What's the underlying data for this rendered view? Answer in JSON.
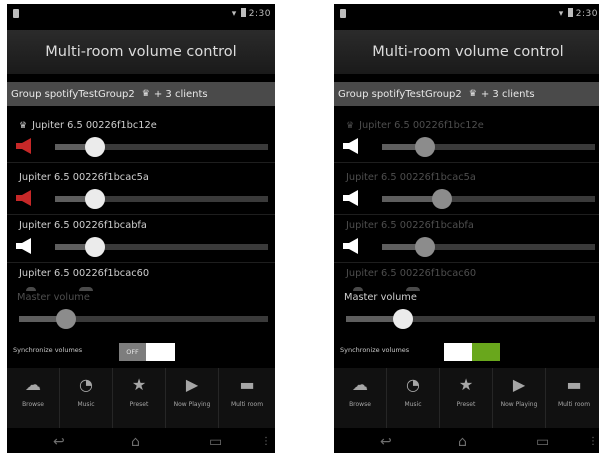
{
  "status": {
    "time": "2:30"
  },
  "title": "Multi-room volume control",
  "group": {
    "name": "Group spotifyTestGroup2",
    "clients": "+ 3 clients"
  },
  "clients": {
    "c0": "Jupiter 6.5 00226f1bc12e",
    "c1": "Jupiter 6.5 00226f1bcac5a",
    "c2": "Jupiter 6.5 00226f1bcabfa",
    "c3": "Jupiter 6.5 00226f1bcac60"
  },
  "master_label": "Master volume",
  "sync_label": "Synchronize volumes",
  "sync_off_text": "OFF",
  "nav": {
    "n0": "Browse",
    "n1": "Music",
    "n2": "Preset",
    "n3": "Now Playing",
    "n4": "Multi room"
  },
  "screens": [
    {
      "client_levels": [
        0.19,
        0.19,
        0.19
      ],
      "master_level": 0.19,
      "sync_on": false
    },
    {
      "client_levels": [
        0.2,
        0.28,
        0.2
      ],
      "master_level": 0.23,
      "sync_on": true
    }
  ],
  "colors": {
    "accent_red": "#c62828",
    "toggle_on": "#69a71c",
    "group_bar": "#4a4a4a"
  },
  "icons": {
    "crown": "crown-icon",
    "speaker": "speaker-icon",
    "browse": "cloud-icon",
    "music": "clock-icon",
    "preset": "star-icon",
    "now_playing": "play-icon",
    "multi_room": "sofa-icon",
    "back": "back-icon",
    "home": "home-icon",
    "recents": "recents-icon"
  }
}
